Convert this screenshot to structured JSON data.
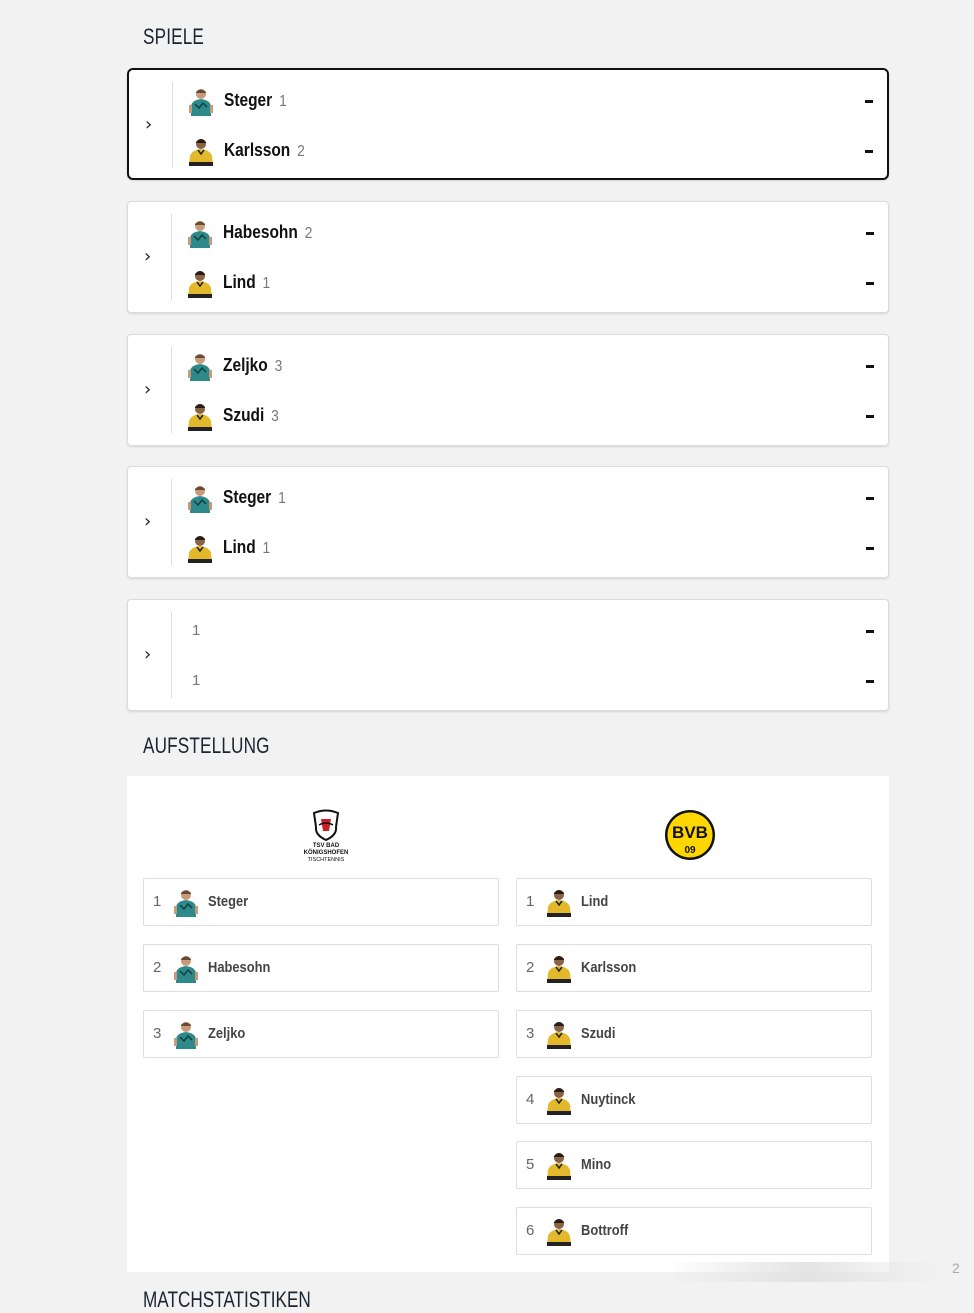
{
  "sections": {
    "games_title": "SPIELE",
    "lineup_title": "AUFSTELLUNG",
    "next_title": "MATCHSTATISTIKEN"
  },
  "score_placeholder": "-",
  "colors": {
    "home_jersey": "#2e8a8a",
    "away_jersey": "#e3b82a",
    "bvb_yellow": "#ffd700",
    "active_border": "#111111"
  },
  "matches": [
    {
      "home": {
        "name": "Steger",
        "num": "1"
      },
      "away": {
        "name": "Karlsson",
        "num": "2"
      },
      "active": true
    },
    {
      "home": {
        "name": "Habesohn",
        "num": "2"
      },
      "away": {
        "name": "Lind",
        "num": "1"
      },
      "active": false
    },
    {
      "home": {
        "name": "Zeljko",
        "num": "3"
      },
      "away": {
        "name": "Szudi",
        "num": "3"
      },
      "active": false
    },
    {
      "home": {
        "name": "Steger",
        "num": "1"
      },
      "away": {
        "name": "Lind",
        "num": "1"
      },
      "active": false
    },
    {
      "home": {
        "name": "",
        "num": "1"
      },
      "away": {
        "name": "",
        "num": "1"
      },
      "active": false
    }
  ],
  "lineup": {
    "home_logo_text": [
      "TSV BAD",
      "KÖNIGSHOFEN",
      "TISCHTENNIS"
    ],
    "away_logo_text": {
      "top": "BVB",
      "bottom": "09"
    },
    "home": [
      {
        "num": "1",
        "name": "Steger"
      },
      {
        "num": "2",
        "name": "Habesohn"
      },
      {
        "num": "3",
        "name": "Zeljko"
      }
    ],
    "away": [
      {
        "num": "1",
        "name": "Lind"
      },
      {
        "num": "2",
        "name": "Karlsson"
      },
      {
        "num": "3",
        "name": "Szudi"
      },
      {
        "num": "4",
        "name": "Nuytinck"
      },
      {
        "num": "5",
        "name": "Mino"
      },
      {
        "num": "6",
        "name": "Bottroff"
      }
    ]
  },
  "page_indicator": "2"
}
